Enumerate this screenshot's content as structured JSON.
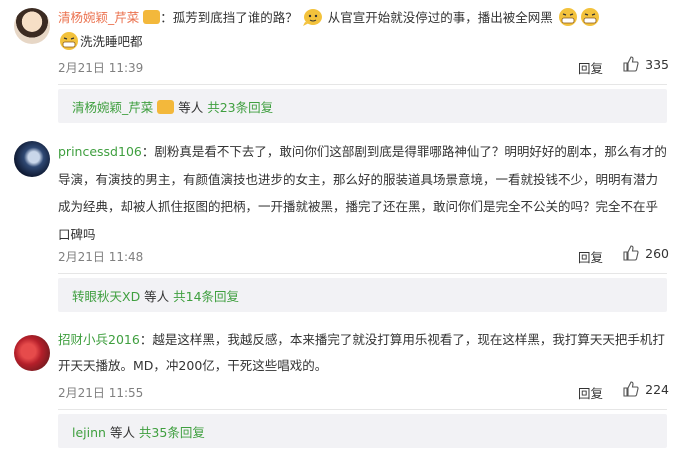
{
  "comments": [
    {
      "username": "清杨婉颖_芹菜",
      "text_part1": "：孤芳到底挡了谁的路？",
      "text_part2": "从官宣开始就没停过的事，播出被全网黑",
      "text_part3": "洗洗睡吧都",
      "time": "2月21日 11:39",
      "reply_label": "回复",
      "likes": "335",
      "sub_user": "清杨婉颖_芹菜",
      "sub_mid": " 等人 ",
      "sub_count": "共23条回复"
    },
    {
      "username": "princessd106",
      "text": "：剧粉真是看不下去了，敢问你们这部剧到底是得罪哪路神仙了？明明好好的剧本，那么有才的导演，有演技的男主，有颜值演技也进步的女主，那么好的服装道具场景意境，一看就投钱不少，明明有潜力成为经典，却被人抓住抠图的把柄，一开播就被黑，播完了还在黑，敢问你们是完全不公关的吗？完全不在乎口碑吗",
      "time": "2月21日 11:48",
      "reply_label": "回复",
      "likes": "260",
      "sub_user": "转眼秋天XD",
      "sub_mid": " 等人 ",
      "sub_count": "共14条回复"
    },
    {
      "username": "招财小兵2016",
      "text": "：越是这样黑，我越反感，本来播完了就没打算用乐视看了，现在这样黑，我打算天天把手机打开天天播放。MD，冲200亿，干死这些唱戏的。",
      "time": "2月21日 11:55",
      "reply_label": "回复",
      "likes": "224",
      "sub_user": "lejinn",
      "sub_mid": " 等人 ",
      "sub_count": "共35条回复"
    }
  ],
  "colors": {
    "username": "#eb7350",
    "reply_link": "#3f9f3f",
    "meta": "#808080",
    "sub_bg": "#f2f2f5"
  },
  "icons": {
    "like": "thumb-up-icon",
    "emoji_bubble": "speech-face-emoji",
    "emoji_grin": "grin-emoji",
    "vip": "vip-badge-icon"
  }
}
